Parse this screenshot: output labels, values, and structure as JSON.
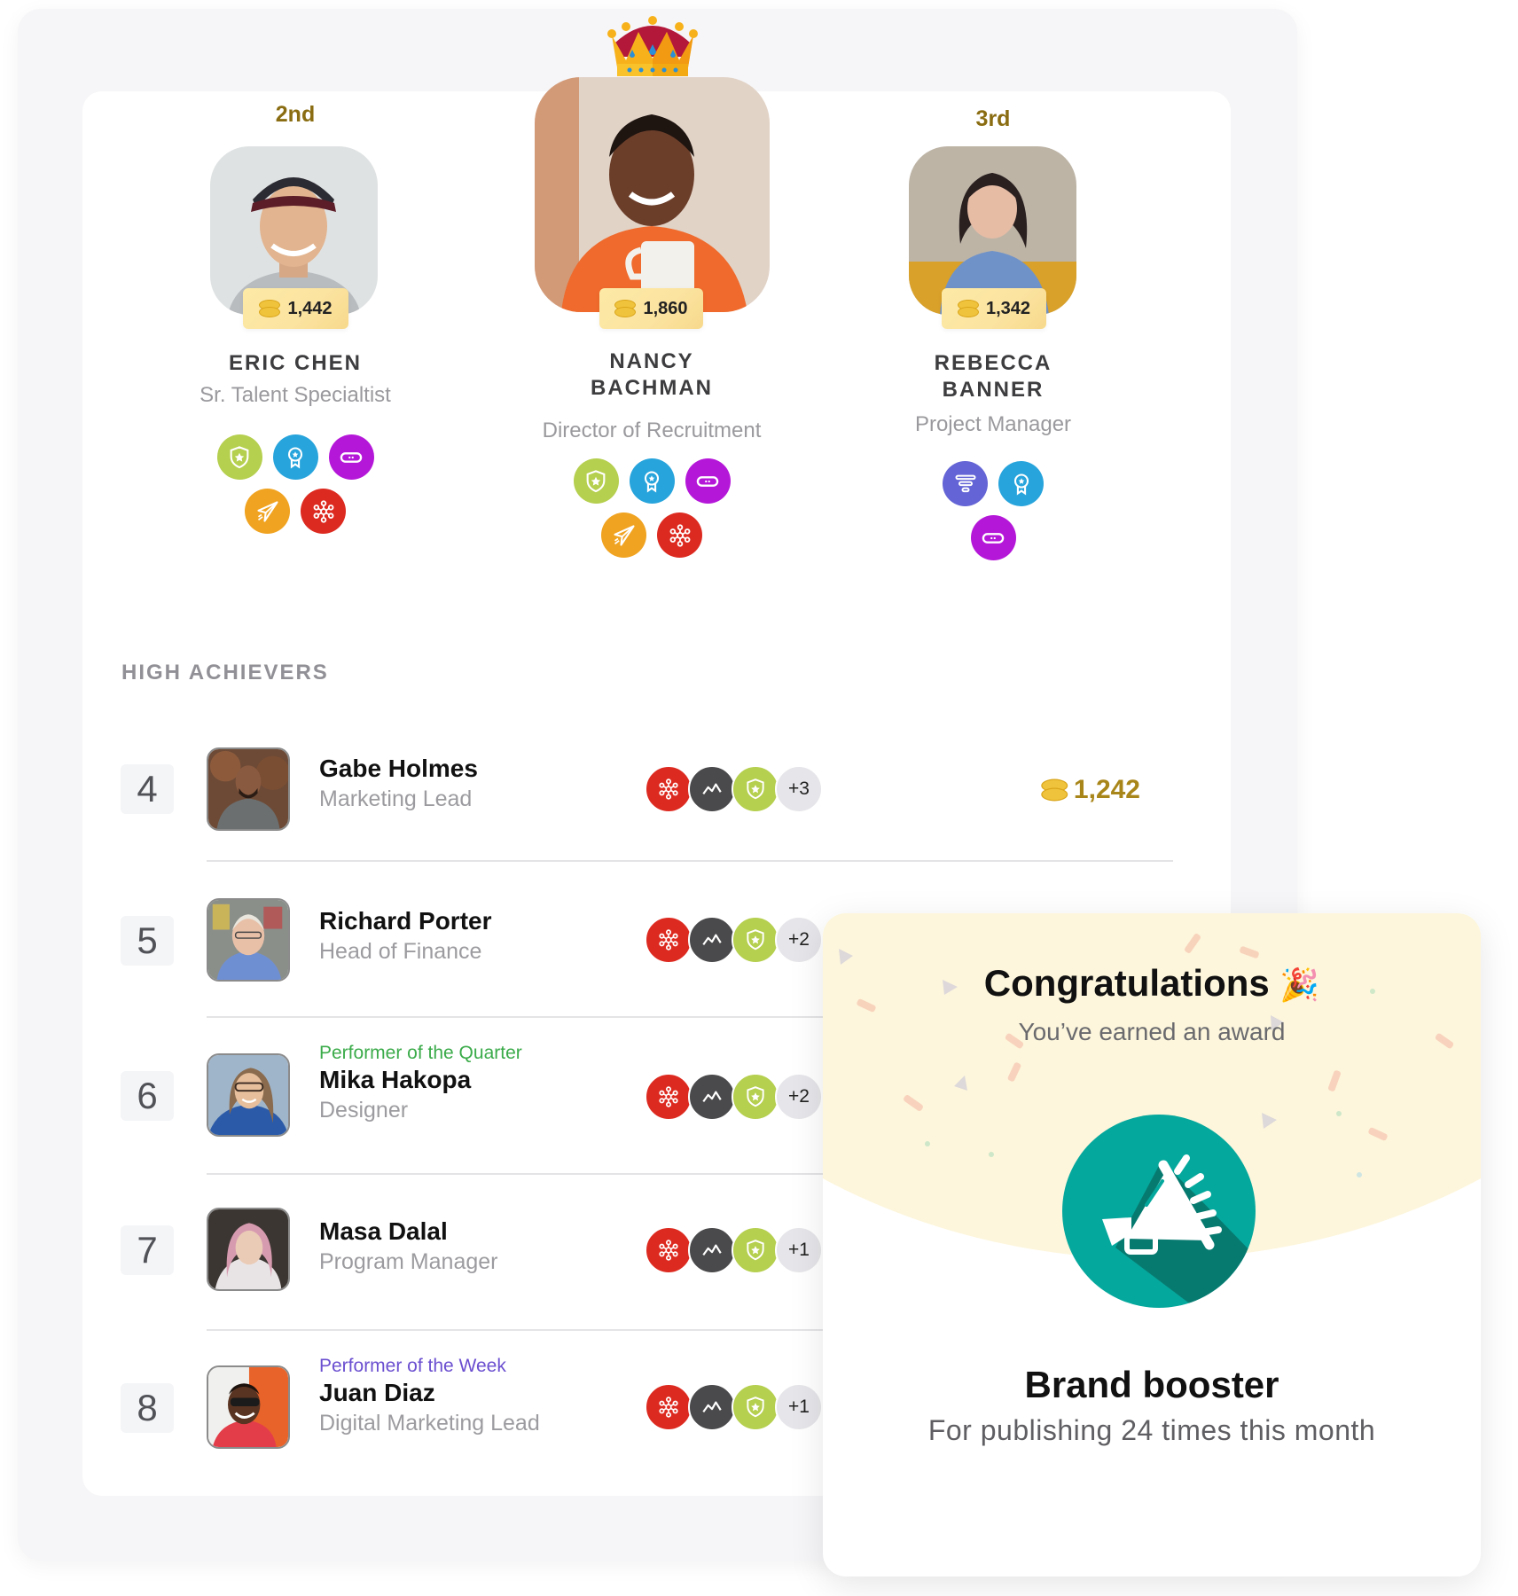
{
  "podium": [
    {
      "place": "2nd",
      "name": "ERIC CHEN",
      "title": "Sr. Talent Specialtist",
      "points": "1,442",
      "badges": [
        "shield-star-badge",
        "ribbon-award-badge",
        "chat-pill-badge",
        "paper-plane-badge",
        "network-badge"
      ]
    },
    {
      "place": "1st",
      "name": "NANCY BACHMAN",
      "name_line1": "NANCY",
      "name_line2": "BACHMAN",
      "title": "Director of Recruitment",
      "points": "1,860",
      "badges": [
        "shield-star-badge",
        "ribbon-award-badge",
        "chat-pill-badge",
        "paper-plane-badge",
        "network-badge"
      ]
    },
    {
      "place": "3rd",
      "name": "REBECCA BANNER",
      "name_line1": "REBECCA",
      "name_line2": "BANNER",
      "title": "Project Manager",
      "points": "1,342",
      "badges": [
        "funnel-badge",
        "ribbon-award-badge",
        "chat-pill-badge"
      ]
    }
  ],
  "high_achievers": {
    "title": "HIGH ACHIEVERS",
    "rows": [
      {
        "rank": "4",
        "name": "Gabe Holmes",
        "title": "Marketing Lead",
        "award": "",
        "more_badges": "+3",
        "points": "1,242"
      },
      {
        "rank": "5",
        "name": "Richard Porter",
        "title": "Head of Finance",
        "award": "",
        "more_badges": "+2",
        "points": ""
      },
      {
        "rank": "6",
        "name": "Mika Hakopa",
        "title": "Designer",
        "award": "Performer of the Quarter",
        "award_color": "#3bab4a",
        "more_badges": "+2",
        "points": ""
      },
      {
        "rank": "7",
        "name": "Masa Dalal",
        "title": "Program Manager",
        "award": "",
        "more_badges": "+1",
        "points": ""
      },
      {
        "rank": "8",
        "name": "Juan Diaz",
        "title": "Digital Marketing Lead",
        "award": "Performer of the Week",
        "award_color": "#6b4fd0",
        "more_badges": "+1",
        "points": ""
      }
    ]
  },
  "award_card": {
    "heading": "Congratulations",
    "heading_emoji": "🎉",
    "subtitle": "You’ve earned an award",
    "award_name": "Brand booster",
    "award_description": "For publishing 24 times this month",
    "icon": "megaphone-icon"
  },
  "colors": {
    "gold_text": "#8a6d12",
    "badge_green": "#b5cf4e",
    "badge_blue": "#27a4dc",
    "badge_purple": "#b517d9",
    "badge_orange": "#f0a320",
    "badge_red": "#dd2a20",
    "badge_indigo": "#6464d6",
    "badge_dark": "#4a4a4c",
    "award_teal": "#05a89d"
  }
}
